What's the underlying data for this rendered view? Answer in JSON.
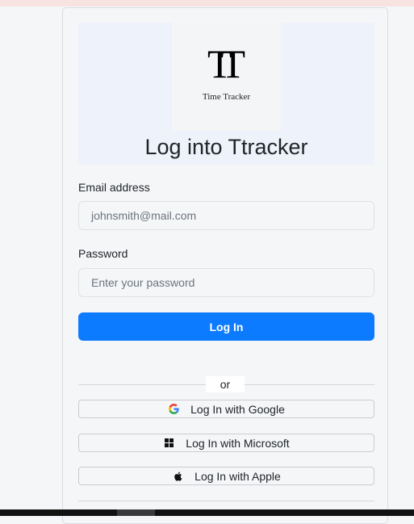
{
  "logo": {
    "mark": "TT",
    "subtitle": "Time Tracker"
  },
  "page": {
    "title": "Log into Ttracker"
  },
  "form": {
    "email_label": "Email address",
    "email_placeholder": "johnsmith@mail.com",
    "password_label": "Password",
    "password_placeholder": "Enter your password",
    "login_label": "Log In"
  },
  "divider": {
    "text": "or"
  },
  "social": [
    {
      "label": "Log In with Google",
      "icon": "google-icon"
    },
    {
      "label": "Log In with Microsoft",
      "icon": "windows-icon"
    },
    {
      "label": "Log In with Apple",
      "icon": "apple-icon"
    }
  ],
  "colors": {
    "primary": "#0d7bff",
    "background": "#f5f6f8"
  }
}
